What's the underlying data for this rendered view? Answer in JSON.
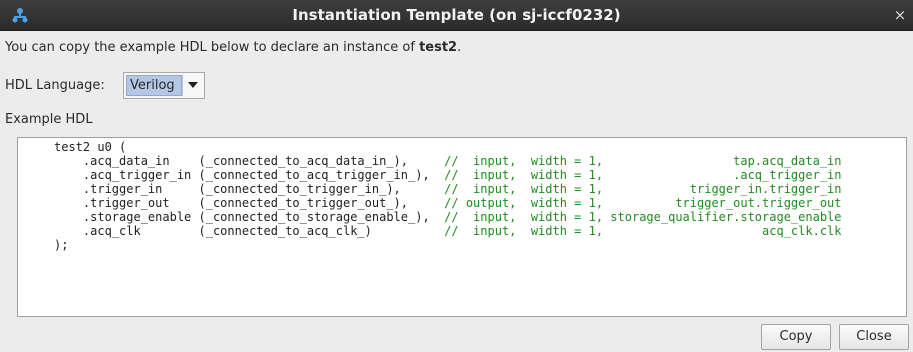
{
  "window": {
    "title": "Instantiation Template (on sj-iccf0232)",
    "close_glyph": "×",
    "app_icon": "network-tree-icon"
  },
  "description": {
    "prefix": "You can copy the example HDL below to declare an instance of ",
    "entity": "test2",
    "suffix": "."
  },
  "language": {
    "label": "HDL Language:",
    "selected": "Verilog"
  },
  "example": {
    "label": "Example HDL",
    "header": "test2 u0 (",
    "ports": [
      {
        "port": ".acq_data_in",
        "conn": "(_connected_to_acq_data_in_),",
        "cmt_slash": "//",
        "dir": " input,",
        "width": "width = 1,",
        "target": "tap.acq_data_in"
      },
      {
        "port": ".acq_trigger_in",
        "conn": "(_connected_to_acq_trigger_in_),",
        "cmt_slash": "//",
        "dir": " input,",
        "width": "width = 1,",
        "target": ".acq_trigger_in"
      },
      {
        "port": ".trigger_in",
        "conn": "(_connected_to_trigger_in_),",
        "cmt_slash": "//",
        "dir": " input,",
        "width": "width = 1,",
        "target": "trigger_in.trigger_in"
      },
      {
        "port": ".trigger_out",
        "conn": "(_connected_to_trigger_out_),",
        "cmt_slash": "//",
        "dir": "output,",
        "width": "width = 1,",
        "target": "trigger_out.trigger_out"
      },
      {
        "port": ".storage_enable",
        "conn": "(_connected_to_storage_enable_),",
        "cmt_slash": "//",
        "dir": " input,",
        "width": "width = 1,",
        "target": "storage_qualifier.storage_enable"
      },
      {
        "port": ".acq_clk",
        "conn": "(_connected_to_acq_clk_)",
        "cmt_slash": "//",
        "dir": " input,",
        "width": "width = 1,",
        "target": "acq_clk.clk"
      }
    ],
    "footer": ");"
  },
  "buttons": {
    "copy": "Copy",
    "close": "Close"
  },
  "colors": {
    "comment": "#228b22",
    "titlebar": "#333333",
    "selection": "#b4c8e6"
  }
}
